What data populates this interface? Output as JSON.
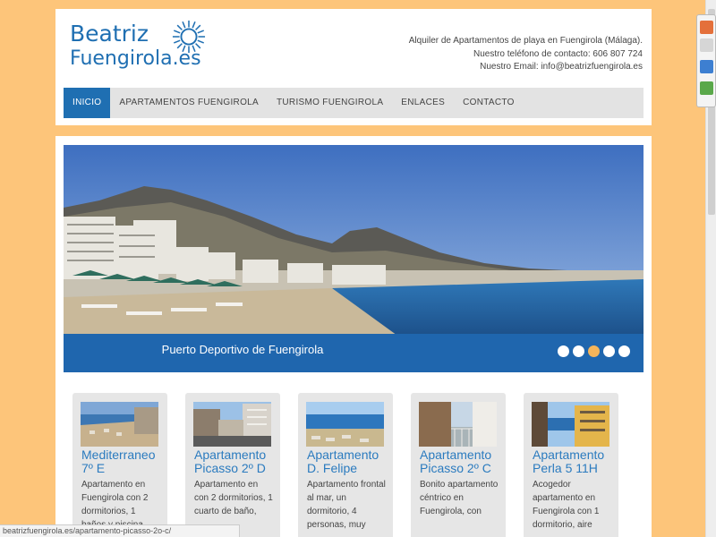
{
  "logo": {
    "line1": "Beatriz",
    "line2": "Fuengirola.es"
  },
  "contact": {
    "line1": "Alquiler de Apartamentos de playa en Fuengirola (Málaga).",
    "line2": "Nuestro teléfono de contacto: 606 807 724",
    "line3": "Nuestro Email: info@beatrizfuengirola.es"
  },
  "nav": [
    {
      "label": "INICIO",
      "active": true
    },
    {
      "label": "APARTAMENTOS FUENGIROLA",
      "active": false
    },
    {
      "label": "TURISMO FUENGIROLA",
      "active": false
    },
    {
      "label": "ENLACES",
      "active": false
    },
    {
      "label": "CONTACTO",
      "active": false
    }
  ],
  "slider": {
    "caption": "Puerto Deportivo de Fuengirola",
    "slide_count": 5,
    "active_slide": 4
  },
  "cards": [
    {
      "title": "Mediterraneo 7º E",
      "desc": "Apartamento en Fuengirola con 2 dormitorios, 1 baños y piscina,"
    },
    {
      "title": "Apartamento Picasso 2º D",
      "desc": "Apartamento en con 2 dormitorios, 1 cuarto de baño,"
    },
    {
      "title": "Apartamento D. Felipe",
      "desc": "Apartamento frontal al mar, un dormitorio, 4 personas, muy"
    },
    {
      "title": "Apartamento Picasso 2º C",
      "desc": "Bonito apartamento céntrico en Fuengirola, con"
    },
    {
      "title": "Apartamento Perla 5 11H",
      "desc": "Acogedor apartamento en Fuengirola con 1 dormitorio, aire"
    }
  ],
  "statusbar": {
    "url": "beatrizfuengirola.es/apartamento-picasso-2o-c/"
  },
  "colors": {
    "accent": "#1F6FB2",
    "background": "#FDC57A",
    "active_dot": "#F5B55A"
  }
}
